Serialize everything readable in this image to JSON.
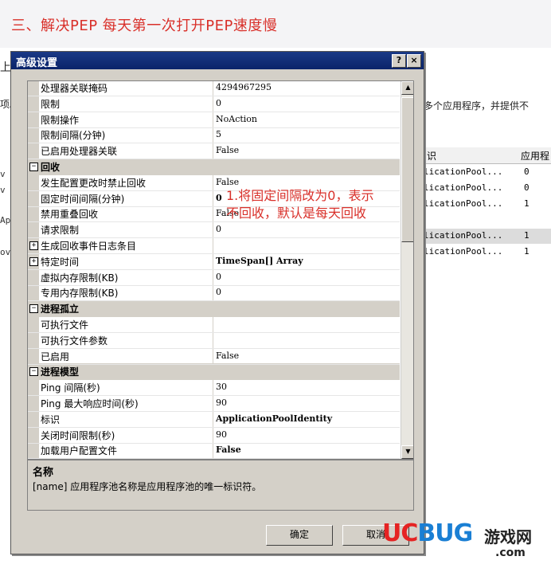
{
  "banner": {
    "title": "三、解决PEP 每天第一次打开PEP速度慢"
  },
  "background": {
    "left_fragments": [
      "上",
      "项。",
      "v",
      "v",
      "Ap",
      "ov"
    ],
    "desc_text": "多个应用程序，并提供不",
    "grid_headers": [
      "识",
      "应用程"
    ],
    "grid_rows": [
      {
        "name": "licationPool...",
        "count": "0"
      },
      {
        "name": "licationPool...",
        "count": "0"
      },
      {
        "name": "licationPool...",
        "count": "1"
      },
      {
        "name": "licationPool...",
        "count": "1"
      },
      {
        "name": "licationPool...",
        "count": "1"
      }
    ]
  },
  "dialog": {
    "title": "高级设置",
    "help_label": "?",
    "close_label": "×",
    "rows": [
      {
        "type": "prop",
        "name": "处理器关联掩码",
        "value": "4294967295"
      },
      {
        "type": "prop",
        "name": "限制",
        "value": "0"
      },
      {
        "type": "prop",
        "name": "限制操作",
        "value": "NoAction"
      },
      {
        "type": "prop",
        "name": "限制间隔(分钟)",
        "value": "5"
      },
      {
        "type": "prop",
        "name": "已启用处理器关联",
        "value": "False"
      },
      {
        "type": "cat",
        "name": "回收",
        "expander": "−"
      },
      {
        "type": "prop",
        "name": "发生配置更改时禁止回收",
        "value": "False"
      },
      {
        "type": "prop",
        "name": "固定时间间隔(分钟)",
        "value": "0",
        "bold": true
      },
      {
        "type": "prop",
        "name": "禁用重叠回收",
        "value": "False"
      },
      {
        "type": "prop",
        "name": "请求限制",
        "value": "0"
      },
      {
        "type": "prop",
        "name": "生成回收事件日志条目",
        "value": "",
        "expander": "+"
      },
      {
        "type": "prop",
        "name": "特定时间",
        "value": "TimeSpan[] Array",
        "bold": true,
        "expander": "+"
      },
      {
        "type": "prop",
        "name": "虚拟内存限制(KB)",
        "value": "0"
      },
      {
        "type": "prop",
        "name": "专用内存限制(KB)",
        "value": "0"
      },
      {
        "type": "cat",
        "name": "进程孤立",
        "expander": "−"
      },
      {
        "type": "prop",
        "name": "可执行文件",
        "value": ""
      },
      {
        "type": "prop",
        "name": "可执行文件参数",
        "value": ""
      },
      {
        "type": "prop",
        "name": "已启用",
        "value": "False"
      },
      {
        "type": "cat",
        "name": "进程模型",
        "expander": "−"
      },
      {
        "type": "prop",
        "name": "Ping 间隔(秒)",
        "value": "30"
      },
      {
        "type": "prop",
        "name": "Ping 最大响应时间(秒)",
        "value": "90"
      },
      {
        "type": "prop",
        "name": "标识",
        "value": "ApplicationPoolIdentity",
        "bold": true
      },
      {
        "type": "prop",
        "name": "关闭时间限制(秒)",
        "value": "90"
      },
      {
        "type": "prop",
        "name": "加载用户配置文件",
        "value": "False",
        "bold": true
      }
    ],
    "annotation": "1.将固定间隔改为0，表示不回收，默认是每天回收",
    "description": {
      "title": "名称",
      "text": "[name] 应用程序池名称是应用程序池的唯一标识符。"
    },
    "ok_label": "确定",
    "cancel_label": "取消"
  },
  "watermark": {
    "uc": "UC",
    "bug": "BUG",
    "cn": "游戏网",
    "com": ".com"
  }
}
